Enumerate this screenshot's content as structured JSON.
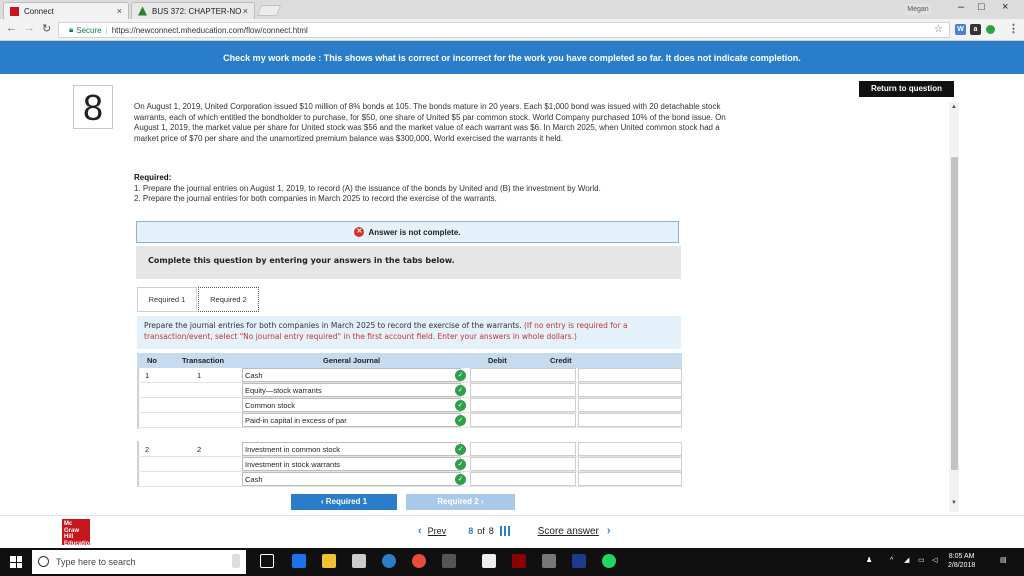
{
  "browser": {
    "tabs": [
      {
        "label": "Connect",
        "close": "×"
      },
      {
        "label": "BUS 372: CHAPTER-NO",
        "close": "×"
      }
    ],
    "profile_label": "Megan",
    "window_controls": {
      "minimize": "–",
      "maximize": "□",
      "close": "×"
    },
    "secure_label": "Secure",
    "url": "https://newconnect.mheducation.com/flow/connect.html"
  },
  "banner": {
    "text": "Check my work mode : This shows what is correct or incorrect for the work you have completed so far. It does not indicate completion."
  },
  "return_button": "Return to question",
  "question": {
    "number": "8",
    "text": "On August 1, 2019, United Corporation issued $10 million of 8% bonds at 105. The bonds mature in 20 years. Each $1,000 bond was issued with 20 detachable stock warrants, each of which entitled the bondholder to purchase, for $50, one share of United $5 par common stock. World Company purchased 10% of the bond issue. On August 1, 2019, the market value per share for United stock was $56 and the market value of each warrant was $6. In March 2025, when United common stock had a market price of $70 per share and the unamortized premium balance was $300,000, World exercised the warrants it held.",
    "required_heading": "Required:",
    "required_1": "1. Prepare the journal entries on August 1, 2019, to record (A) the issuance of the bonds by United and (B) the investment by World.",
    "required_2": "2. Prepare the journal entries for both companies in March 2025 to record the exercise of the warrants."
  },
  "answer_status": "Answer is not complete.",
  "complete_prompt": "Complete this question by entering your answers in the tabs below.",
  "req_tabs": [
    "Required 1",
    "Required 2"
  ],
  "instructions": {
    "main": "Prepare the journal entries for both companies in March 2025 to record the exercise of the warrants.",
    "hint": "(If no entry is required for a transaction/event, select \"No journal entry required\" in the first account field. Enter your answers in whole dollars.)"
  },
  "journal": {
    "headers": {
      "no": "No",
      "transaction": "Transaction",
      "general_journal": "General Journal",
      "debit": "Debit",
      "credit": "Credit"
    },
    "entries": [
      {
        "no": "1",
        "transaction": "1",
        "accounts": [
          "Cash",
          "Equity—stock warrants",
          "Common stock",
          "Paid-in capital in excess of par"
        ]
      },
      {
        "no": "2",
        "transaction": "2",
        "accounts": [
          "Investment in common stock",
          "Investment in stock warrants",
          "Cash"
        ]
      }
    ]
  },
  "bottom_nav": {
    "prev": "‹  Required 1",
    "next": "Required 2  ›"
  },
  "footer": {
    "logo": "Mc Graw Hill Education",
    "prev": "Prev",
    "page": "8",
    "of": "of",
    "total": "8",
    "score": "Score answer"
  },
  "taskbar": {
    "search_placeholder": "Type here to search",
    "time": "8:05 AM",
    "date": "2/8/2018"
  }
}
